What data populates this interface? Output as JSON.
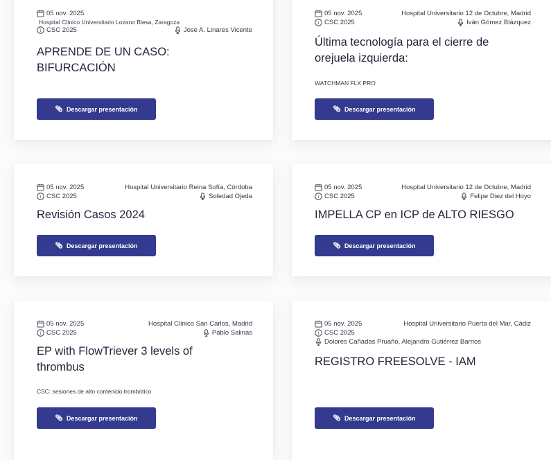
{
  "download_label": "Descargar presentación",
  "colors": {
    "button_bg": "#333a8f",
    "button_text": "#ffffff"
  },
  "cards": [
    {
      "date": "05 nov. 2025",
      "location": "Hospital Clínico Universitario Lozano Blesa, Zaragoza",
      "event": "CSC 2025",
      "speaker": "Jose A. Linares Vicente",
      "title": "APRENDE DE UN CASO: BIFURCACIÓN",
      "description": ""
    },
    {
      "date": "05 nov. 2025",
      "location": "Hospital Universitario 12 de Octubre, Madrid",
      "event": "CSC 2025",
      "speaker": "Iván Gómez Blázquez",
      "title": "Última tecnología para el cierre de orejuela izquierda:",
      "description": "WATCHMAN FLX PRO"
    },
    {
      "date": "05 nov. 2025",
      "location": "Hospital Universitario Reina Sofía, Córdoba",
      "event": "CSC 2025",
      "speaker": "Soledad Ojeda",
      "title": "Revisión Casos 2024",
      "description": ""
    },
    {
      "date": "05 nov. 2025",
      "location": "Hospital Universitario 12 de Octubre, Madrid",
      "event": "CSC 2025",
      "speaker": "Felipe Diez del Hoyo",
      "title": "IMPELLA CP en ICP de ALTO RIESGO",
      "description": ""
    },
    {
      "date": "05 nov. 2025",
      "location": "Hospital Clínico San Carlos, Madrid",
      "event": "CSC 2025",
      "speaker": "Pablo Salinas",
      "title": "EP with FlowTriever 3 levels of thrombus",
      "description": "CSC: sesiones de alto contenido trombótico"
    },
    {
      "date": "05 nov. 2025",
      "location": "Hospital Universitario Puerta del Mar, Cádiz",
      "event": "CSC 2025",
      "speaker": "Dolores Cañadas Pruaño, Alejandro Gutiérrez Barrios",
      "title": "REGISTRO FREESOLVE - IAM",
      "description": ""
    }
  ]
}
